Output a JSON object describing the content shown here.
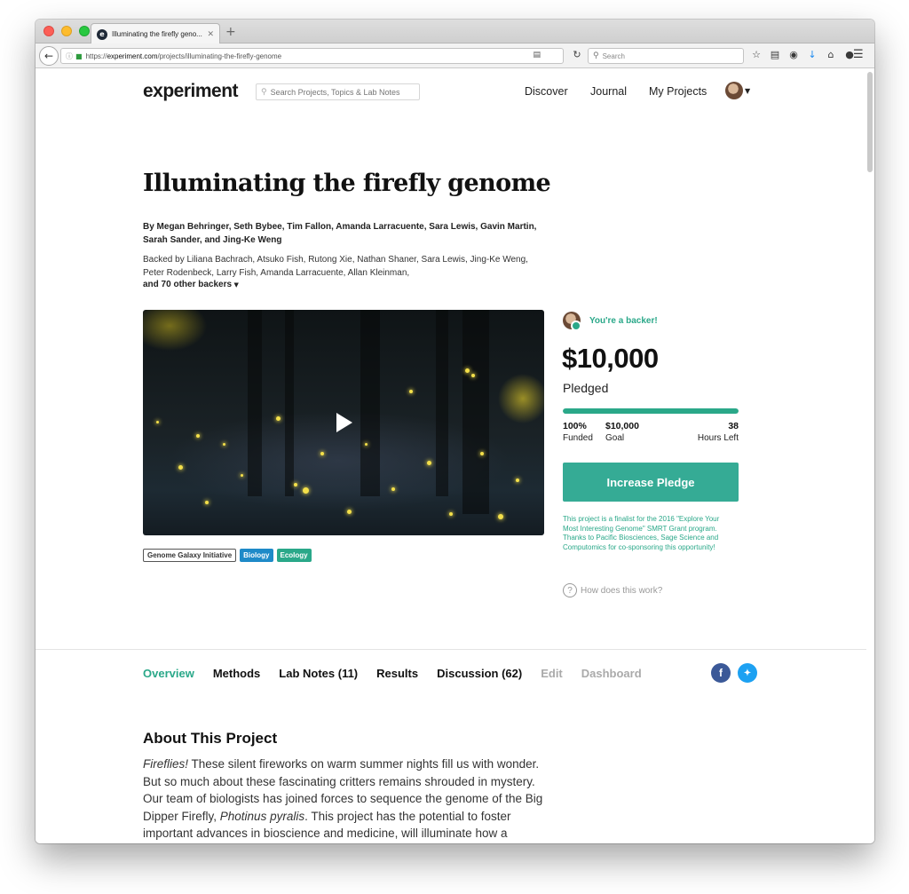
{
  "browser": {
    "tab_title": "Illuminating the firefly geno...",
    "tab_close": "✕",
    "new_tab": "+",
    "url_prefix": "https://",
    "url_domain": "experiment.com",
    "url_path": "/projects/illuminating-the-firefly-genome",
    "search_placeholder": "Search"
  },
  "site": {
    "logo": "experiment",
    "search_placeholder": "Search Projects, Topics & Lab Notes",
    "nav": [
      "Discover",
      "Journal",
      "My Projects"
    ]
  },
  "project": {
    "title": "Illuminating the firefly genome",
    "authors": "By Megan Behringer, Seth Bybee, Tim Fallon, Amanda Larracuente, Sara Lewis, Gavin Martin, Sarah Sander, and Jing-Ke Weng",
    "backers": "Backed by Liliana Bachrach, Atsuko Fish, Rutong Xie, Nathan Shaner, Sara Lewis, Jing-Ke Weng, Peter Rodenbeck, Larry Fish, Amanda Larracuente, Allan Kleinman,",
    "backers_more": "and 70 other backers",
    "tags": [
      "Genome Galaxy Initiative",
      "Biology",
      "Ecology"
    ]
  },
  "funding": {
    "backer_badge": "You're a backer!",
    "amount": "$10,000",
    "pledged_label": "Pledged",
    "progress_fraction": 1.0,
    "funded_value": "100%",
    "funded_label": "Funded",
    "goal_value": "$10,000",
    "goal_label": "Goal",
    "hours_value": "38",
    "hours_label": "Hours Left",
    "button": "Increase Pledge",
    "finalist_note": "This project is a finalist for the 2016 \"Explore Your Most Interesting Genome\" SMRT Grant program. Thanks to Pacific Biosciences, Sage Science and Computomics for co-sponsoring this opportunity!",
    "how_it_works": "How does this work?"
  },
  "tabs": {
    "overview": "Overview",
    "methods": "Methods",
    "lab_notes": "Lab Notes (11)",
    "results": "Results",
    "discussion": "Discussion (62)",
    "edit": "Edit",
    "dashboard": "Dashboard"
  },
  "about": {
    "heading": "About This Project",
    "lead": "Fireflies!",
    "text_1": " These silent fireworks on warm summer nights fill us with wonder. But so much about these fascinating critters remains shrouded in mystery. Our team of biologists has joined forces to sequence the genome of the Big Dipper Firefly, ",
    "species": "Photinus pyralis",
    "text_2": ". This project has the potential to foster important advances in bioscience and medicine, will illuminate how a complex trait like light production"
  },
  "colors": {
    "accent": "#2aa889",
    "button": "#35ab95",
    "biology_tag": "#1e8ac8",
    "facebook": "#3b5998",
    "twitter": "#1da1f2"
  }
}
